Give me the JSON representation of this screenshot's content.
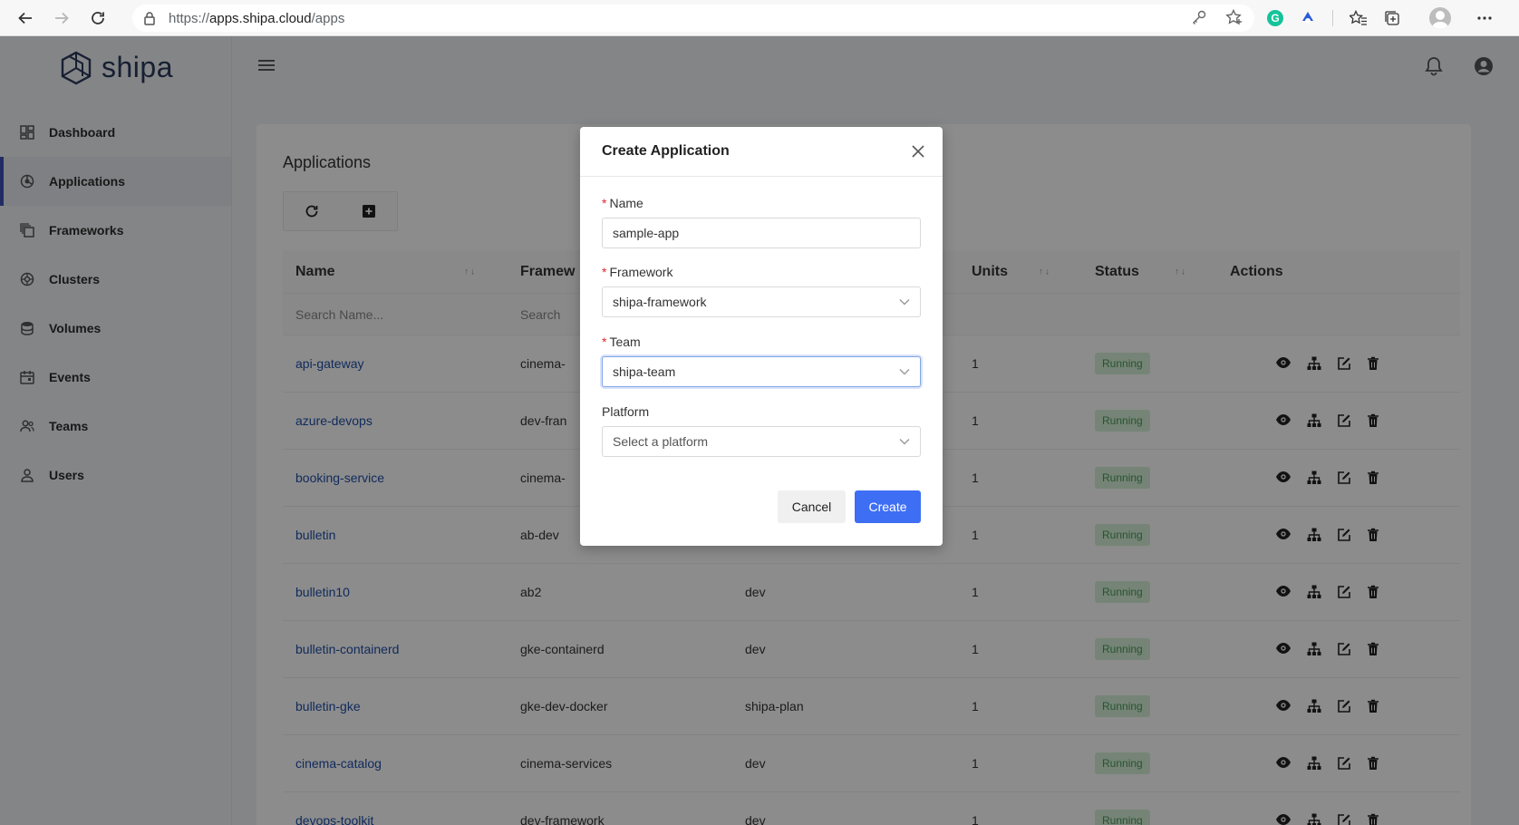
{
  "browser": {
    "url_prefix": "https://",
    "url_domain": "apps.shipa.cloud",
    "url_path": "/apps"
  },
  "brand": {
    "name": "shipa"
  },
  "sidebar": {
    "items": [
      {
        "label": "Dashboard",
        "icon": "dashboard-icon"
      },
      {
        "label": "Applications",
        "icon": "applications-icon",
        "active": true
      },
      {
        "label": "Frameworks",
        "icon": "frameworks-icon"
      },
      {
        "label": "Clusters",
        "icon": "clusters-icon"
      },
      {
        "label": "Volumes",
        "icon": "volumes-icon"
      },
      {
        "label": "Events",
        "icon": "events-icon"
      },
      {
        "label": "Teams",
        "icon": "teams-icon"
      },
      {
        "label": "Users",
        "icon": "users-icon"
      }
    ]
  },
  "page": {
    "title": "Applications",
    "columns": {
      "name": "Name",
      "framework": "Framew",
      "units": "Units",
      "status": "Status",
      "actions": "Actions"
    },
    "filters": {
      "name_placeholder": "Search Name...",
      "framework_placeholder": "Search"
    },
    "rows": [
      {
        "name": "api-gateway",
        "framework": "cinema-",
        "plan": "",
        "units": "1",
        "status": "Running"
      },
      {
        "name": "azure-devops",
        "framework": "dev-fran",
        "plan": "",
        "units": "1",
        "status": "Running"
      },
      {
        "name": "booking-service",
        "framework": "cinema-",
        "plan": "",
        "units": "1",
        "status": "Running"
      },
      {
        "name": "bulletin",
        "framework": "ab-dev",
        "plan": "",
        "units": "1",
        "status": "Running"
      },
      {
        "name": "bulletin10",
        "framework": "ab2",
        "plan": "dev",
        "units": "1",
        "status": "Running"
      },
      {
        "name": "bulletin-containerd",
        "framework": "gke-containerd",
        "plan": "dev",
        "units": "1",
        "status": "Running"
      },
      {
        "name": "bulletin-gke",
        "framework": "gke-dev-docker",
        "plan": "shipa-plan",
        "units": "1",
        "status": "Running"
      },
      {
        "name": "cinema-catalog",
        "framework": "cinema-services",
        "plan": "dev",
        "units": "1",
        "status": "Running"
      },
      {
        "name": "devops-toolkit",
        "framework": "dev-framework",
        "plan": "dev",
        "units": "1",
        "status": "Running"
      }
    ]
  },
  "modal": {
    "title": "Create Application",
    "required_mark": "*",
    "name_label": "Name",
    "name_value": "sample-app",
    "framework_label": "Framework",
    "framework_value": "shipa-framework",
    "team_label": "Team",
    "team_value": "shipa-team",
    "platform_label": "Platform",
    "platform_placeholder": "Select a platform",
    "cancel_label": "Cancel",
    "create_label": "Create"
  },
  "colors": {
    "accent": "#3e6ef3",
    "link": "#1f4fa8",
    "running_bg": "#d6f0d8",
    "running_text": "#4a9a5a",
    "required": "#e0282e"
  }
}
